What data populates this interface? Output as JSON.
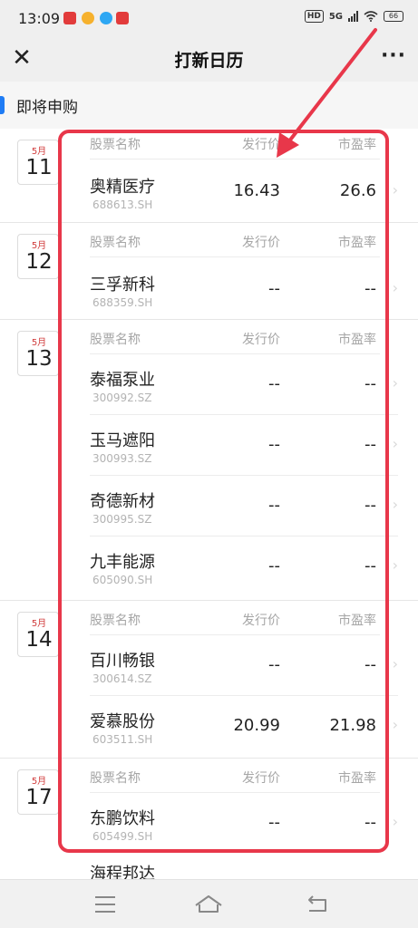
{
  "status_bar": {
    "time": "13:09",
    "network": "5G",
    "hd": "HD",
    "battery": "66"
  },
  "nav": {
    "title": "打新日历",
    "close_icon": "close-icon",
    "more_icon": "more-icon"
  },
  "section": {
    "title": "即将申购"
  },
  "columns": {
    "name": "股票名称",
    "price": "发行价",
    "pe": "市盈率"
  },
  "groups": [
    {
      "month": "5月",
      "day": "11",
      "stocks": [
        {
          "name": "奥精医疗",
          "code": "688613.SH",
          "price": "16.43",
          "pe": "26.6"
        }
      ]
    },
    {
      "month": "5月",
      "day": "12",
      "stocks": [
        {
          "name": "三孚新科",
          "code": "688359.SH",
          "price": "--",
          "pe": "--"
        }
      ]
    },
    {
      "month": "5月",
      "day": "13",
      "stocks": [
        {
          "name": "泰福泵业",
          "code": "300992.SZ",
          "price": "--",
          "pe": "--"
        },
        {
          "name": "玉马遮阳",
          "code": "300993.SZ",
          "price": "--",
          "pe": "--"
        },
        {
          "name": "奇德新材",
          "code": "300995.SZ",
          "price": "--",
          "pe": "--"
        },
        {
          "name": "九丰能源",
          "code": "605090.SH",
          "price": "--",
          "pe": "--"
        }
      ]
    },
    {
      "month": "5月",
      "day": "14",
      "stocks": [
        {
          "name": "百川畅银",
          "code": "300614.SZ",
          "price": "--",
          "pe": "--"
        },
        {
          "name": "爱慕股份",
          "code": "603511.SH",
          "price": "20.99",
          "pe": "21.98"
        }
      ]
    },
    {
      "month": "5月",
      "day": "17",
      "stocks": [
        {
          "name": "东鹏饮料",
          "code": "605499.SH",
          "price": "--",
          "pe": "--"
        }
      ]
    }
  ],
  "partial_next": {
    "name": "海程邦达"
  },
  "colors": {
    "highlight": "#e8374a",
    "accent": "#1f7cf5",
    "month": "#d03a3a"
  }
}
